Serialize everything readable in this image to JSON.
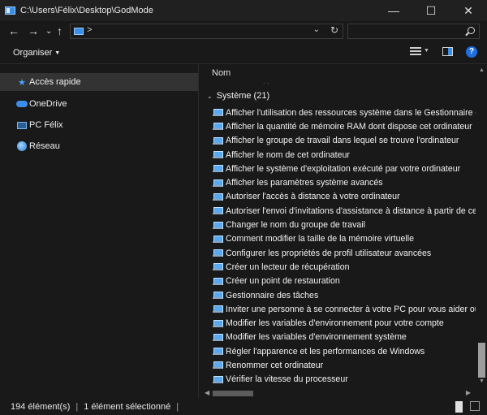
{
  "window": {
    "title": "C:\\Users\\Félix\\Desktop\\GodMode",
    "minimize": "—",
    "maximize": "☐",
    "close": "✕"
  },
  "nav": {
    "back": "←",
    "forward": "→",
    "recent": "⌄",
    "up": "↑",
    "address_sep": ">",
    "address_dropdown": "⌄",
    "refresh": "↻",
    "search_placeholder": ""
  },
  "toolbar": {
    "organise_label": "Organiser"
  },
  "sidebar": {
    "items": [
      {
        "label": "Accès rapide",
        "icon": "star-icon"
      },
      {
        "label": "OneDrive",
        "icon": "cloud-icon"
      },
      {
        "label": "PC Félix",
        "icon": "computer-icon"
      },
      {
        "label": "Réseau",
        "icon": "network-icon"
      }
    ]
  },
  "content": {
    "column_name": "Nom",
    "column_dots": ".                             .",
    "group_label": "Système (21)",
    "items": [
      "Afficher l'utilisation des ressources système dans le Gestionnaire des tâc",
      "Afficher la quantité de mémoire RAM dont dispose cet ordinateur",
      "Afficher le groupe de travail dans lequel se trouve l'ordinateur",
      "Afficher le nom de cet ordinateur",
      "Afficher le système d'exploitation exécuté par votre ordinateur",
      "Afficher les paramètres système avancés",
      "Autoriser l'accès à distance à votre ordinateur",
      "Autoriser l'envoi d'invitations d'assistance à distance à partir de cet ordin",
      "Changer le nom du groupe de travail",
      "Comment modifier la taille de la mémoire virtuelle",
      "Configurer les propriétés de profil utilisateur avancées",
      "Créer un lecteur de récupération",
      "Créer un point de restauration",
      "Gestionnaire des tâches",
      "Inviter une personne à se connecter à votre PC pour vous aider ou prop",
      "Modifier les variables d'environnement pour votre compte",
      "Modifier les variables d'environnement système",
      "Régler l'apparence et les performances de Windows",
      "Renommer cet ordinateur",
      "Vérifier la vitesse du processeur"
    ]
  },
  "status": {
    "count": "194 élément(s)",
    "selected": "1 élément sélectionné"
  },
  "colors": {
    "background": "#191919",
    "accent": "#1f6fe0",
    "selection": "#333333"
  }
}
